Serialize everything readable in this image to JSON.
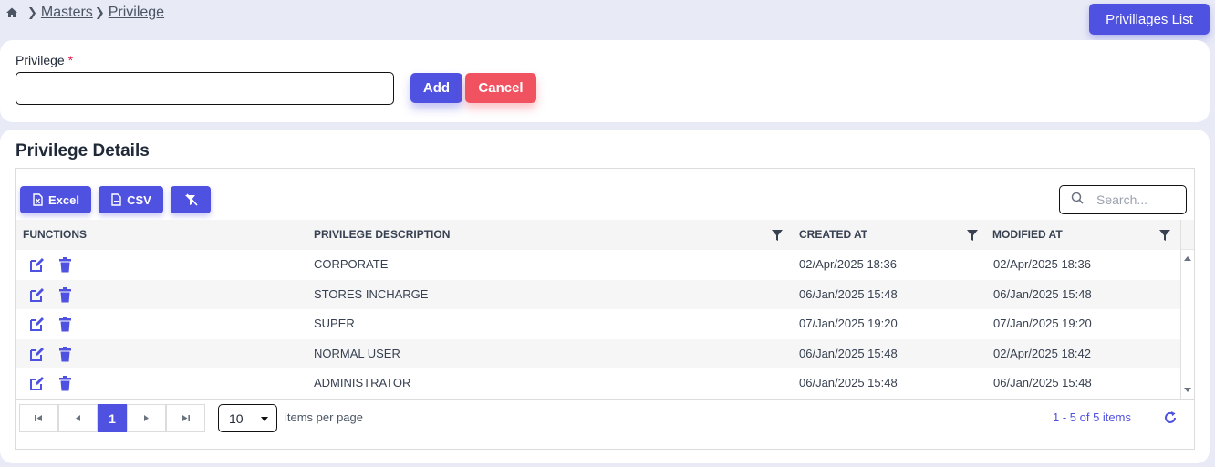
{
  "breadcrumb": {
    "items": [
      "Masters",
      "Privilege"
    ]
  },
  "header": {
    "list_button": "Privillages List"
  },
  "form": {
    "label": "Privilege",
    "required_mark": "*",
    "input_value": "",
    "add_label": "Add",
    "cancel_label": "Cancel"
  },
  "details": {
    "title": "Privilege Details",
    "toolbar": {
      "excel": "Excel",
      "csv": "CSV"
    },
    "search_placeholder": "Search...",
    "columns": [
      "FUNCTIONS",
      "PRIVILEGE DESCRIPTION",
      "CREATED AT",
      "MODIFIED AT"
    ],
    "rows": [
      {
        "description": "CORPORATE",
        "created": "02/Apr/2025 18:36",
        "modified": "02/Apr/2025 18:36"
      },
      {
        "description": "STORES INCHARGE",
        "created": "06/Jan/2025 15:48",
        "modified": "06/Jan/2025 15:48"
      },
      {
        "description": "SUPER",
        "created": "07/Jan/2025 19:20",
        "modified": "07/Jan/2025 19:20"
      },
      {
        "description": "NORMAL USER",
        "created": "06/Jan/2025 15:48",
        "modified": "02/Apr/2025 18:42"
      },
      {
        "description": "ADMINISTRATOR",
        "created": "06/Jan/2025 15:48",
        "modified": "06/Jan/2025 15:48"
      }
    ],
    "pager": {
      "current_page": "1",
      "page_size": "10",
      "items_per_page_label": "items per page",
      "count_text": "1 - 5 of 5 items"
    }
  },
  "colors": {
    "primary": "#4f51e0",
    "danger": "#f0535f",
    "background": "#e8eaf6"
  },
  "icons": [
    "home-icon",
    "chevron-right-icon",
    "excel-icon",
    "csv-icon",
    "clear-filter-icon",
    "search-icon",
    "filter-icon",
    "edit-icon",
    "delete-icon",
    "first-page-icon",
    "prev-page-icon",
    "next-page-icon",
    "last-page-icon",
    "refresh-icon"
  ]
}
